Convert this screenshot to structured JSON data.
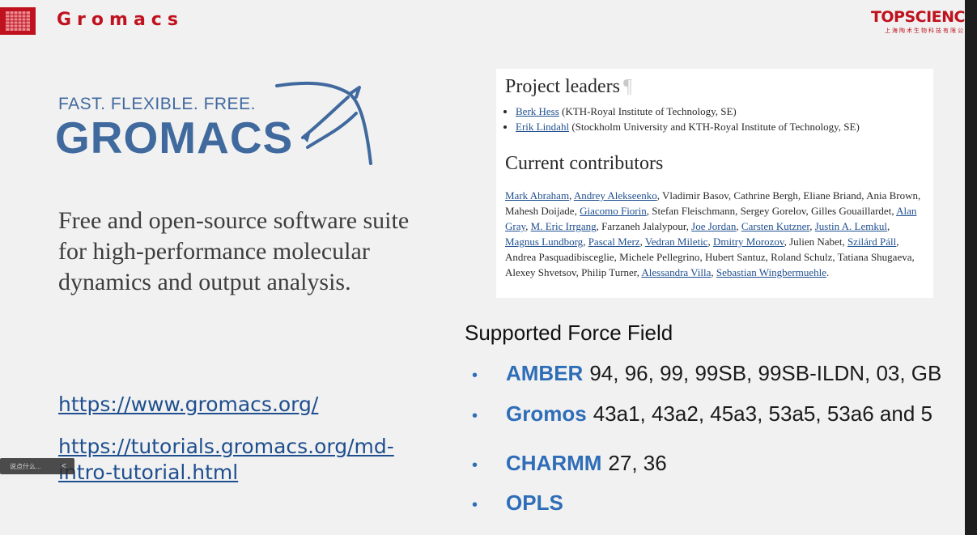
{
  "header": {
    "title": "Gromacs"
  },
  "brand": {
    "name": "TOPSCIENC",
    "sub": "上海陶术生物科技有限公"
  },
  "logo": {
    "tagline": "FAST. FLEXIBLE. FREE.",
    "word": "GROMACS"
  },
  "description": "Free and open-source software suite for high-performance molecular dynamics and output analysis.",
  "links": [
    {
      "text": "https://www.gromacs.org/"
    },
    {
      "text": "https://tutorials.gromacs.org/md-intro-tutorial.html"
    }
  ],
  "toolbar": {
    "text": "说点什么...",
    "button": "<"
  },
  "panel": {
    "leaders_heading": "Project leaders",
    "pilcrow": "¶",
    "leaders": [
      {
        "name": "Berk Hess",
        "affiliation": " (KTH-Royal Institute of Technology, SE)"
      },
      {
        "name": "Erik Lindahl",
        "affiliation": " (Stockholm University and KTH-Royal Institute of Technology, SE)"
      }
    ],
    "contributors_heading": "Current contributors",
    "contributors": [
      {
        "name": "Mark Abraham",
        "link": true
      },
      {
        "name": "Andrey Alekseenko",
        "link": true
      },
      {
        "name": "Vladimir Basov",
        "link": false
      },
      {
        "name": "Cathrine Bergh",
        "link": false
      },
      {
        "name": "Eliane Briand",
        "link": false
      },
      {
        "name": "Ania Brown",
        "link": false
      },
      {
        "name": "Mahesh Doijade",
        "link": false
      },
      {
        "name": "Giacomo Fiorin",
        "link": true
      },
      {
        "name": "Stefan Fleischmann",
        "link": false
      },
      {
        "name": "Sergey Gorelov",
        "link": false
      },
      {
        "name": "Gilles Gouaillardet",
        "link": false
      },
      {
        "name": "Alan Gray",
        "link": true
      },
      {
        "name": "M. Eric Irrgang",
        "link": true
      },
      {
        "name": "Farzaneh Jalalypour",
        "link": false
      },
      {
        "name": "Joe Jordan",
        "link": true
      },
      {
        "name": "Carsten Kutzner",
        "link": true
      },
      {
        "name": "Justin A. Lemkul",
        "link": true
      },
      {
        "name": "Magnus Lundborg",
        "link": true
      },
      {
        "name": "Pascal Merz",
        "link": true
      },
      {
        "name": "Vedran Miletic",
        "link": true
      },
      {
        "name": "Dmitry Morozov",
        "link": true
      },
      {
        "name": "Julien Nabet",
        "link": false
      },
      {
        "name": "Szilárd Páll",
        "link": true
      },
      {
        "name": "Andrea Pasquadibisceglie",
        "link": false
      },
      {
        "name": "Michele Pellegrino",
        "link": false
      },
      {
        "name": "Hubert Santuz",
        "link": false
      },
      {
        "name": "Roland Schulz",
        "link": false
      },
      {
        "name": "Tatiana Shugaeva",
        "link": false
      },
      {
        "name": "Alexey Shvetsov",
        "link": false
      },
      {
        "name": "Philip Turner",
        "link": false
      },
      {
        "name": "Alessandra Villa",
        "link": true
      },
      {
        "name": "Sebastian Wingbermuehle",
        "link": true
      }
    ]
  },
  "force_fields": {
    "heading": "Supported Force Field",
    "bullet": "•",
    "items": [
      {
        "name": "AMBER",
        "versions": "94, 96, 99, 99SB, 99SB-ILDN, 03, GB"
      },
      {
        "name": "Gromos",
        "versions": "43a1, 43a2, 45a3, 53a5, 53a6 and 5"
      },
      {
        "name": "CHARMM",
        "versions": "27, 36"
      },
      {
        "name": "OPLS",
        "versions": ""
      }
    ]
  },
  "colors": {
    "accent_red": "#c0121e",
    "logo_blue": "#40699e",
    "ff_blue": "#2e6db8",
    "link_blue": "#1f4f8f"
  }
}
